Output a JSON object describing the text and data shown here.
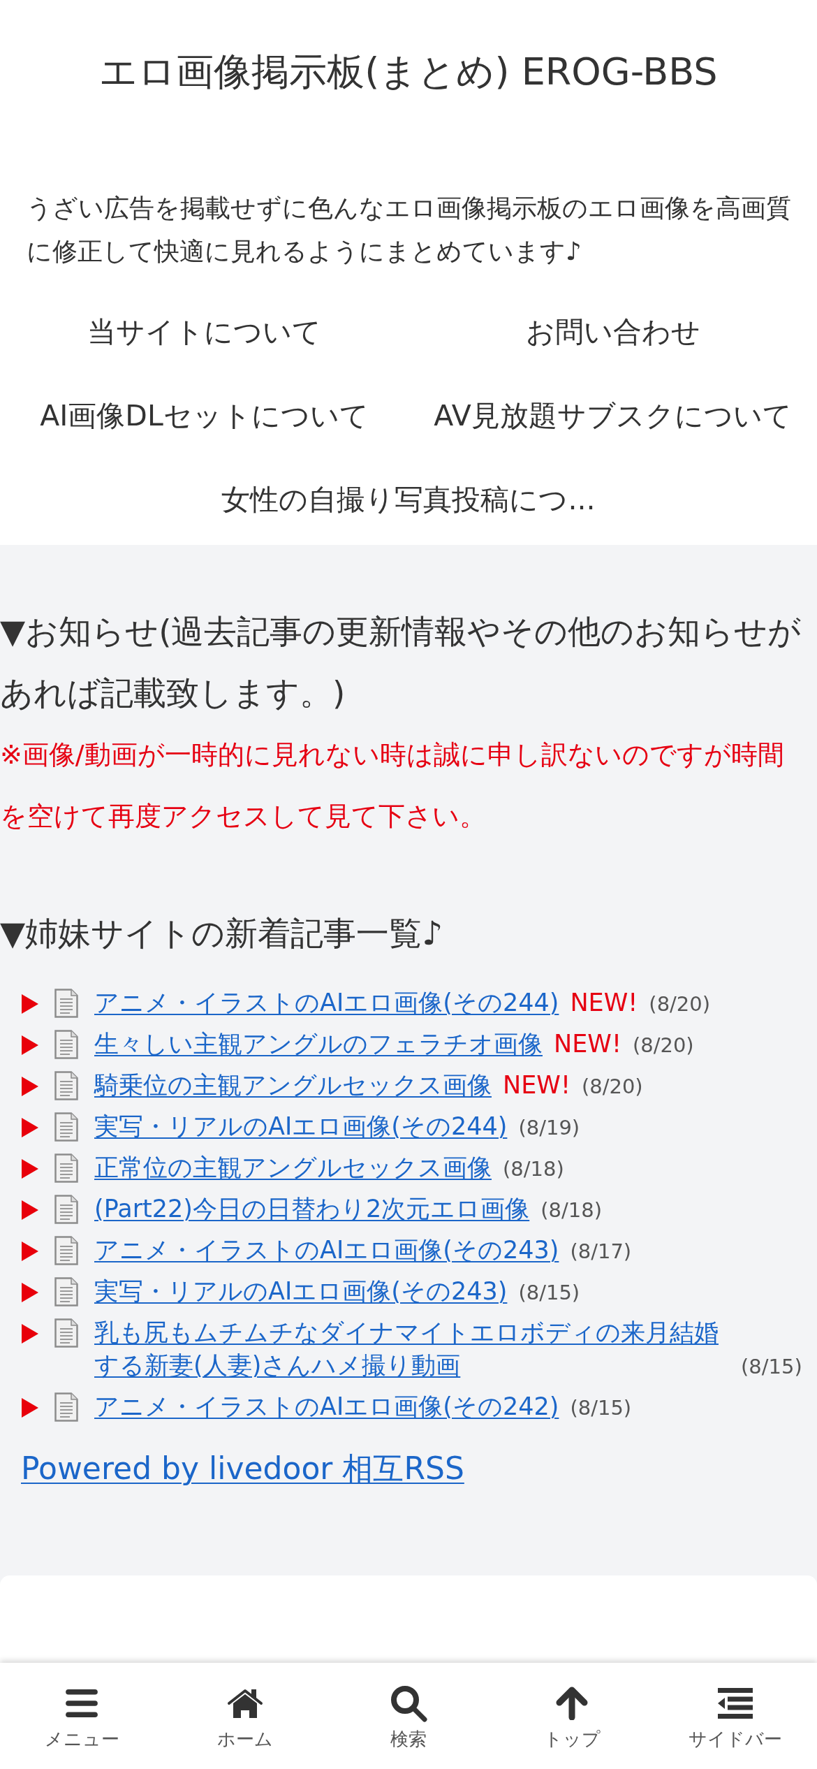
{
  "header": {
    "title": "エロ画像掲示板(まとめ) EROG-BBS",
    "description": "うざい広告を掲載せずに色んなエロ画像掲示板のエロ画像を高画質に修正して快適に見れるようにまとめています♪"
  },
  "nav_links": [
    {
      "label": "当サイトについて"
    },
    {
      "label": "お問い合わせ"
    },
    {
      "label": "AI画像DLセットについて"
    },
    {
      "label": "AV見放題サブスクについて"
    },
    {
      "label": "女性の自撮り写真投稿につ..."
    }
  ],
  "notice": {
    "heading": "▼お知らせ(過去記事の更新情報やその他のお知らせがあれば記載致します。)",
    "note": "※画像/動画が一時的に見れない時は誠に申し訳ないのですが時間を空けて再度アクセスして見て下さい。"
  },
  "sister_sites": {
    "heading": "▼姉妹サイトの新着記事一覧♪",
    "articles": [
      {
        "title": "アニメ・イラストのAIエロ画像(その244)",
        "badge": "NEW!",
        "date": "(8/20)"
      },
      {
        "title": "生々しい主観アングルのフェラチオ画像",
        "badge": "NEW!",
        "date": "(8/20)"
      },
      {
        "title": "騎乗位の主観アングルセックス画像",
        "badge": "NEW!",
        "date": "(8/20)"
      },
      {
        "title": "実写・リアルのAIエロ画像(その244)",
        "date": "(8/19)"
      },
      {
        "title": "正常位の主観アングルセックス画像",
        "date": "(8/18)"
      },
      {
        "title": "(Part22)今日の日替わり2次元エロ画像",
        "date": "(8/18)"
      },
      {
        "title": "アニメ・イラストのAIエロ画像(その243)",
        "date": "(8/17)"
      },
      {
        "title": "実写・リアルのAIエロ画像(その243)",
        "date": "(8/15)"
      },
      {
        "title": "乳も尻もムチムチなダイナマイトエロボディの来月結婚する新妻(人妻)さんハメ撮り動画",
        "date": "(8/15)"
      },
      {
        "title": "アニメ・イラストのAIエロ画像(その242)",
        "date": "(8/15)"
      }
    ],
    "powered_by": "Powered by livedoor 相互RSS"
  },
  "bottom_nav": [
    {
      "kind": "menu",
      "label": "メニュー"
    },
    {
      "kind": "home",
      "label": "ホーム"
    },
    {
      "kind": "search",
      "label": "検索"
    },
    {
      "kind": "top",
      "label": "トップ"
    },
    {
      "kind": "sidebar",
      "label": "サイドバー"
    }
  ]
}
